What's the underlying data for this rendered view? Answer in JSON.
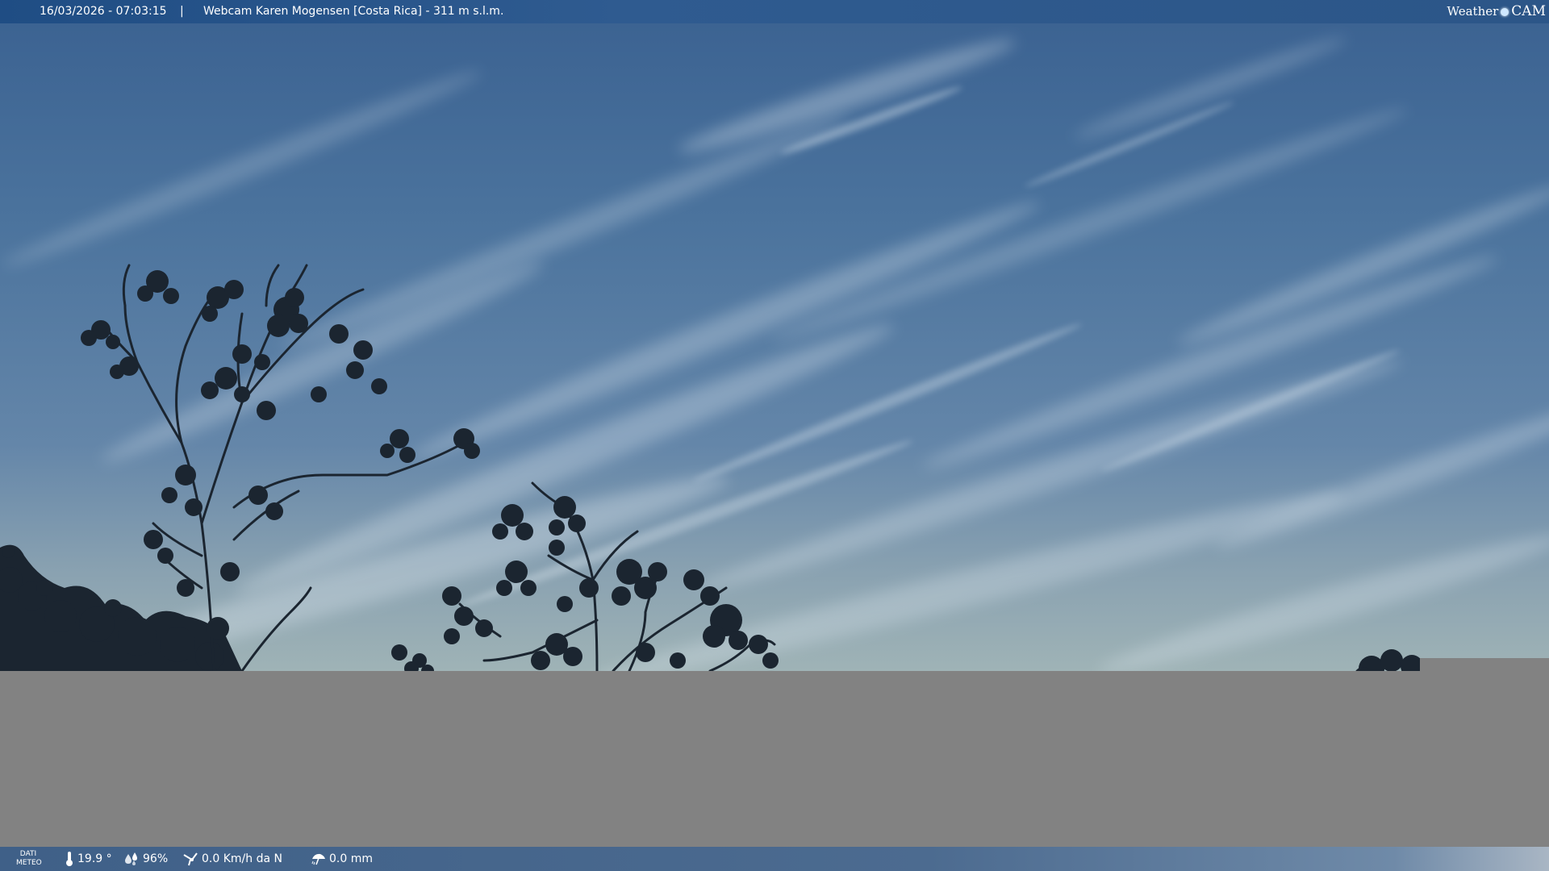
{
  "overlay": {
    "timestamp": "16/03/2026 - 07:03:15",
    "separator": "|",
    "title": "Webcam Karen Mogensen [Costa Rica]  - 311 m s.l.m.",
    "logo": {
      "weather": "Weather",
      "cam": "CAM"
    }
  },
  "weather": {
    "section_label_line1": "DATI",
    "section_label_line2": "METEO",
    "temperature": "19.9 °",
    "humidity": "96%",
    "wind": "0.0 Km/h da N",
    "rain": "0.0 mm"
  },
  "icons": {
    "temperature": "thermometer-icon",
    "humidity": "humidity-drops-icon",
    "wind": "wind-icon",
    "rain": "rain-umbrella-icon",
    "logo_dot": "globe-dot-icon"
  },
  "colors": {
    "bar": "#2c5688",
    "sky_top": "#3c6392",
    "sky_bottom": "#9fb3b6",
    "grey_fill": "#828282",
    "foliage": "#1b2530"
  }
}
